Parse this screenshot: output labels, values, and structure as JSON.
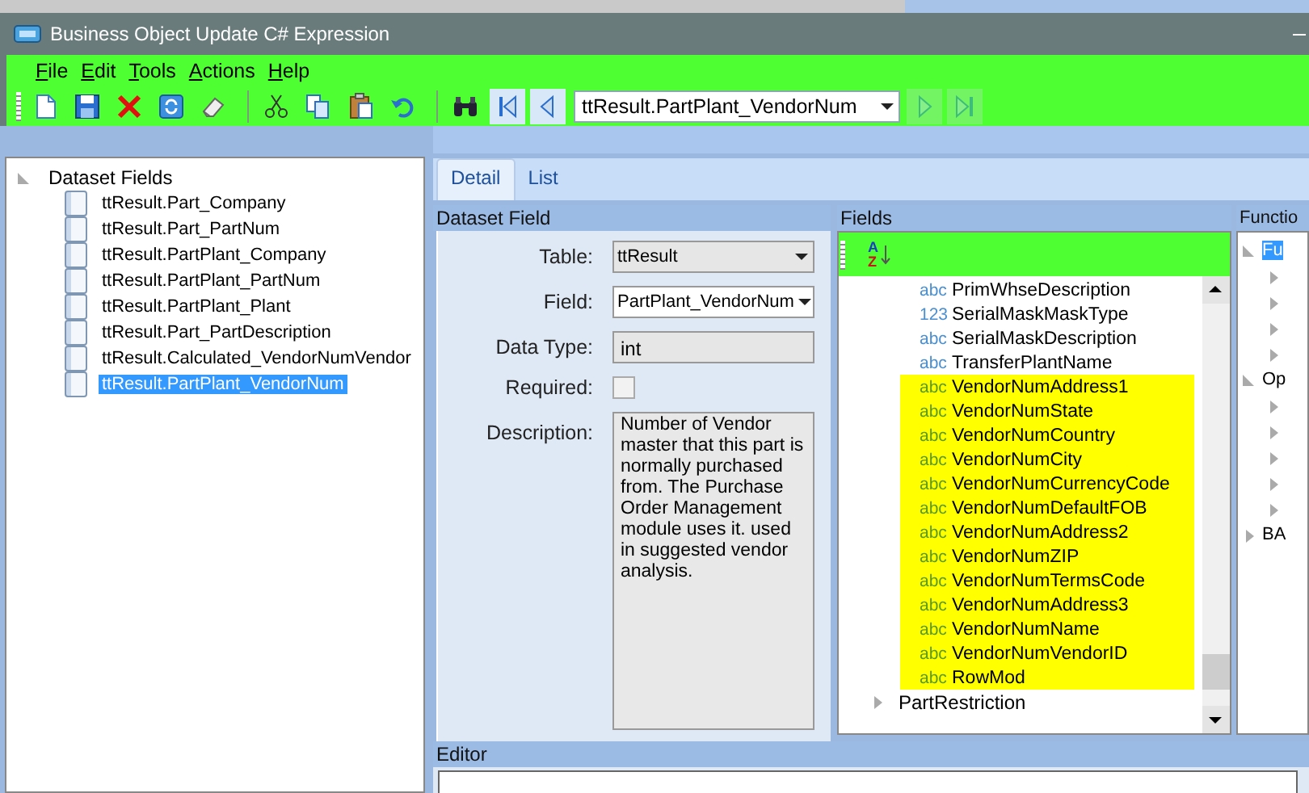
{
  "window": {
    "title": "Business Object Update C# Expression"
  },
  "menu": [
    {
      "label": "File"
    },
    {
      "label": "Edit"
    },
    {
      "label": "Tools"
    },
    {
      "label": "Actions"
    },
    {
      "label": "Help"
    }
  ],
  "toolbar": [
    {
      "kind": "new",
      "disabled": false
    },
    {
      "kind": "save",
      "disabled": false
    },
    {
      "kind": "delete",
      "disabled": false
    },
    {
      "kind": "refresh",
      "disabled": false
    },
    {
      "kind": "clear",
      "disabled": false
    },
    {
      "kind": "sep"
    },
    {
      "kind": "cut",
      "disabled": false
    },
    {
      "kind": "copy",
      "disabled": false
    },
    {
      "kind": "paste",
      "disabled": false
    },
    {
      "kind": "undo",
      "disabled": false
    },
    {
      "kind": "sep"
    },
    {
      "kind": "search",
      "disabled": false
    },
    {
      "kind": "first",
      "disabled": false
    },
    {
      "kind": "prev",
      "disabled": false
    },
    {
      "kind": "combo",
      "value": "ttResult.PartPlant_VendorNum"
    },
    {
      "kind": "next",
      "disabled": true
    },
    {
      "kind": "last",
      "disabled": true
    }
  ],
  "tree": {
    "label": "Dataset Fields",
    "expanded": true,
    "children": [
      {
        "label": "ttResult.Part_Company",
        "selected": false
      },
      {
        "label": "ttResult.Part_PartNum",
        "selected": false
      },
      {
        "label": "ttResult.PartPlant_Company",
        "selected": false
      },
      {
        "label": "ttResult.PartPlant_PartNum",
        "selected": false
      },
      {
        "label": "ttResult.PartPlant_Plant",
        "selected": false
      },
      {
        "label": "ttResult.Part_PartDescription",
        "selected": false
      },
      {
        "label": "ttResult.Calculated_VendorNumVendor",
        "selected": false
      },
      {
        "label": "ttResult.PartPlant_VendorNum",
        "selected": true
      }
    ]
  },
  "tabs": [
    {
      "label": "Detail",
      "selected": true
    },
    {
      "label": "List",
      "selected": false
    }
  ],
  "dataset_field": {
    "title": "Dataset Field",
    "table": {
      "label": "Table:",
      "value": "ttResult"
    },
    "field": {
      "label": "Field:",
      "value": "PartPlant_VendorNum"
    },
    "data_type": {
      "label": "Data Type:",
      "value": "int"
    },
    "required": {
      "label": "Required:",
      "checked": false
    },
    "description": {
      "label": "Description:",
      "value": "Number of Vendor master that this part is normally purchased from. The Purchase Order Management module uses it.  used in suggested vendor analysis."
    }
  },
  "fields": {
    "title": "Fields",
    "items": [
      {
        "type": "abc",
        "name": "PrimWhseDescription",
        "highlighted": false
      },
      {
        "type": "123",
        "name": "SerialMaskMaskType",
        "highlighted": false
      },
      {
        "type": "abc",
        "name": "SerialMaskDescription",
        "highlighted": false
      },
      {
        "type": "abc",
        "name": "TransferPlantName",
        "highlighted": false
      },
      {
        "type": "abc",
        "name": "VendorNumAddress1",
        "highlighted": true
      },
      {
        "type": "abc",
        "name": "VendorNumState",
        "highlighted": true
      },
      {
        "type": "abc",
        "name": "VendorNumCountry",
        "highlighted": true
      },
      {
        "type": "abc",
        "name": "VendorNumCity",
        "highlighted": true
      },
      {
        "type": "abc",
        "name": "VendorNumCurrencyCode",
        "highlighted": true
      },
      {
        "type": "abc",
        "name": "VendorNumDefaultFOB",
        "highlighted": true
      },
      {
        "type": "abc",
        "name": "VendorNumAddress2",
        "highlighted": true
      },
      {
        "type": "abc",
        "name": "VendorNumZIP",
        "highlighted": true
      },
      {
        "type": "abc",
        "name": "VendorNumTermsCode",
        "highlighted": true
      },
      {
        "type": "abc",
        "name": "VendorNumAddress3",
        "highlighted": true
      },
      {
        "type": "abc",
        "name": "VendorNumName",
        "highlighted": true
      },
      {
        "type": "abc",
        "name": "VendorNumVendorID",
        "highlighted": true
      },
      {
        "type": "abc",
        "name": "RowMod",
        "highlighted": true
      }
    ],
    "next_group": "PartRestriction",
    "sort_button": {
      "top": "A",
      "bottom": "Z"
    }
  },
  "functions": {
    "title": "Functio",
    "nodes": [
      {
        "label": "Fu",
        "expanded": true,
        "selected": true,
        "children": [
          {
            "expanded": false
          },
          {
            "expanded": false
          },
          {
            "expanded": false
          },
          {
            "expanded": false
          }
        ]
      },
      {
        "label": "Op",
        "expanded": true,
        "selected": false,
        "children": [
          {
            "expanded": false
          },
          {
            "expanded": false
          },
          {
            "expanded": false
          },
          {
            "expanded": false
          },
          {
            "expanded": false
          }
        ]
      },
      {
        "label": "BA",
        "expanded": false,
        "selected": false
      }
    ]
  },
  "editor": {
    "title": "Editor"
  }
}
